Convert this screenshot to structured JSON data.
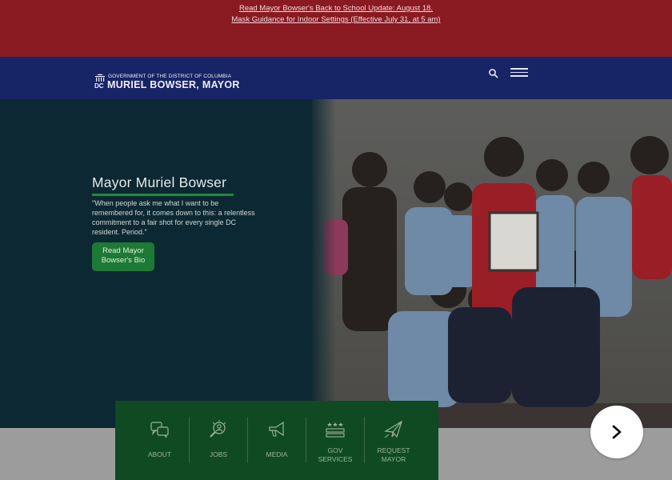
{
  "alerts": [
    "Read Mayor Bowser's Back to School Update: August 18.",
    "Mask Guidance for Indoor Settings (Effective July 31, at 5 am)"
  ],
  "header": {
    "logo_small": "GOVERNMENT OF THE DISTRICT OF COLUMBIA",
    "logo_big": "MURIEL BOWSER, MAYOR",
    "search_icon": "search-icon",
    "menu_icon": "hamburger-menu-icon"
  },
  "hero": {
    "title": "Mayor Muriel Bowser",
    "quote": "\"When people ask me what I want to be remembered for, it comes down to this: a relentless commitment to a fair shot for every single DC resident. Period.\"",
    "button_line1": "Read Mayor",
    "button_line2": "Bowser's Bio"
  },
  "quick_links": [
    {
      "line1": "ABOUT",
      "line2": "",
      "icon": "speech-bubbles-icon"
    },
    {
      "line1": "JOBS",
      "line2": "",
      "icon": "magnifier-person-icon"
    },
    {
      "line1": "MEDIA",
      "line2": "",
      "icon": "megaphone-icon"
    },
    {
      "line1": "GOV",
      "line2": "SERVICES",
      "icon": "dc-flag-icon"
    },
    {
      "line1": "REQUEST",
      "line2": "MAYOR",
      "icon": "paper-plane-icon"
    }
  ],
  "next_icon": "chevron-right-icon",
  "colors": {
    "alert_bg": "#8a1a22",
    "header_bg": "#172466",
    "hero_bg": "#0c2630",
    "accent_green": "#1e8a3c",
    "quick_links_bg": "#0f4a22"
  }
}
